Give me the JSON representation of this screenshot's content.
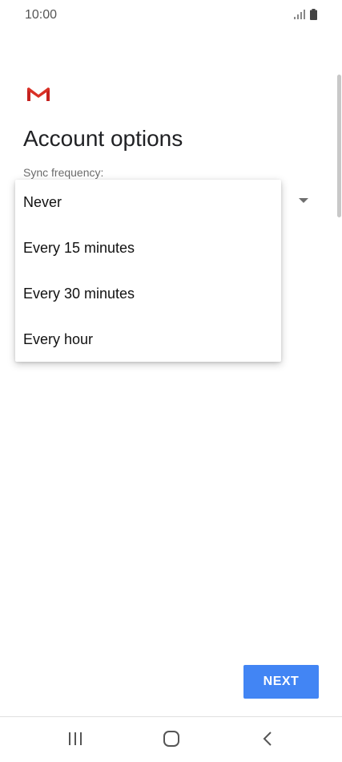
{
  "status_bar": {
    "time": "10:00",
    "signal_icon": "signal-icon",
    "battery_icon": "battery-icon"
  },
  "header": {
    "logo_icon": "gmail-logo-icon",
    "title": "Account options"
  },
  "sync": {
    "label": "Sync frequency:",
    "options": [
      {
        "label": "Never"
      },
      {
        "label": "Every 15 minutes"
      },
      {
        "label": "Every 30 minutes"
      },
      {
        "label": "Every hour"
      }
    ]
  },
  "actions": {
    "next_label": "NEXT"
  },
  "nav_bar": {
    "recent_icon": "recent-apps-icon",
    "home_icon": "home-icon",
    "back_icon": "back-icon"
  },
  "colors": {
    "accent": "#4285f4",
    "gmail_red": "#d93025",
    "text": "#202124",
    "label": "#6b6b6b"
  }
}
